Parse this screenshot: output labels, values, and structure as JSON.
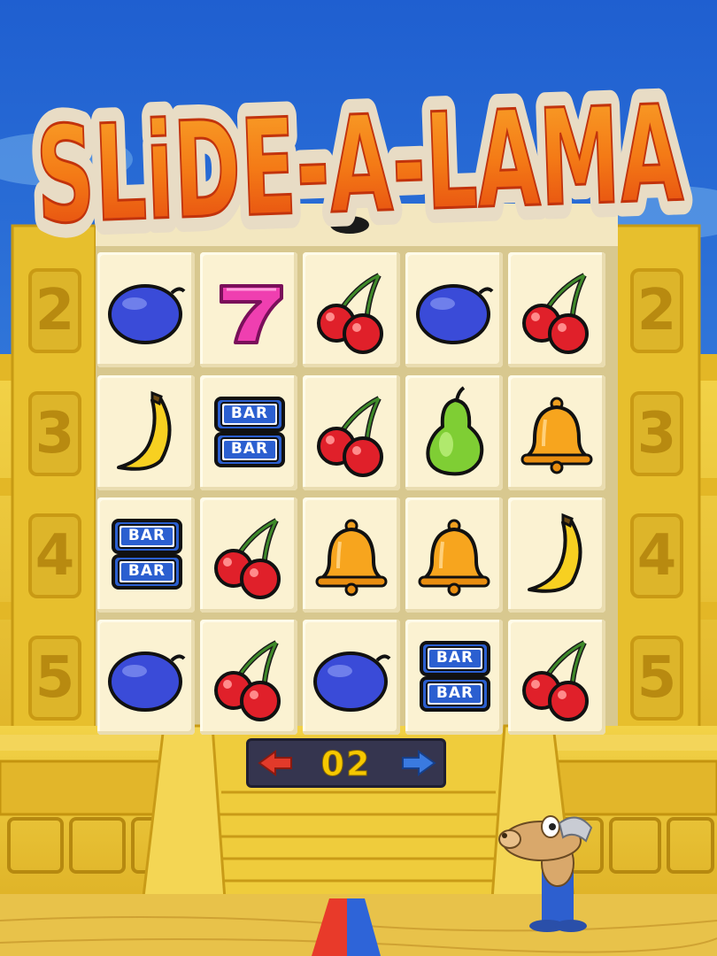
{
  "game": {
    "title": "SLiDE-A-LAMA",
    "counter": "02",
    "row_numbers": [
      "2",
      "3",
      "4",
      "5"
    ],
    "grid": [
      [
        "plum",
        "seven",
        "cherry",
        "plum",
        "cherry"
      ],
      [
        "banana",
        "bar",
        "cherry",
        "pear",
        "bell"
      ],
      [
        "bar",
        "cherry",
        "bell",
        "bell",
        "banana"
      ],
      [
        "plum",
        "cherry",
        "plum",
        "bar",
        "cherry"
      ]
    ],
    "bar_label": "BAR"
  },
  "colors": {
    "sky": "#2a6fd6",
    "temple_gold": "#e9c230",
    "title_orange": "#f47a16",
    "counter_bg": "#35354f",
    "counter_text": "#f6c800",
    "arrow_left": "#e23a2a",
    "arrow_right": "#3a7ae0"
  },
  "icons": {
    "left": "left-arrow-icon",
    "right": "right-arrow-icon"
  }
}
